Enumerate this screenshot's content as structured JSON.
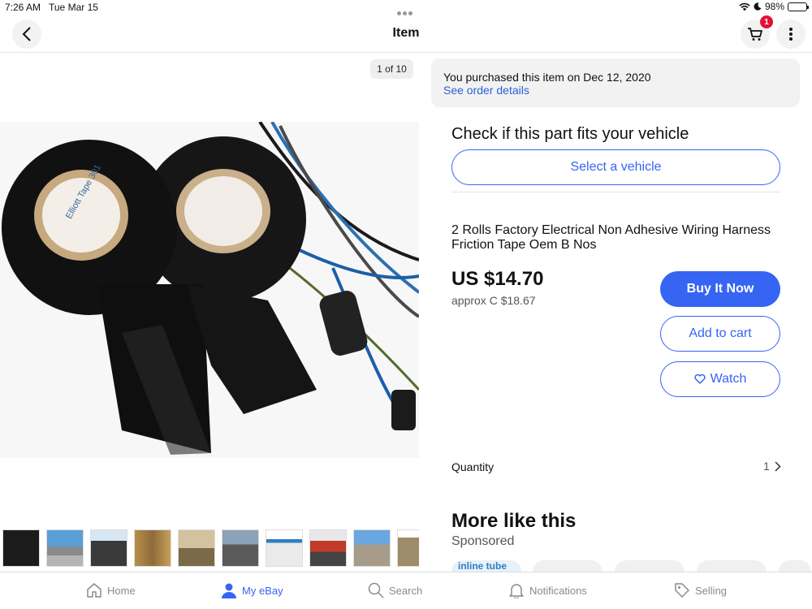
{
  "status_bar": {
    "time": "7:26 AM",
    "date": "Tue Mar 15",
    "battery": "98%",
    "battery_level": 0.98
  },
  "header": {
    "title": "Item",
    "cart_count": "1"
  },
  "gallery": {
    "counter": "1 of 10",
    "tape_label": "Elliott Tape 301",
    "thumbnails": [
      "tape",
      "inline-tube-store",
      "customer-support",
      "warehouse-shelves",
      "warehouse-aisles",
      "workshop",
      "inline-tube-catalog",
      "inline-tube-machine",
      "inline-tube-building",
      "inline-tube-inventory"
    ]
  },
  "purchase": {
    "message": "You purchased this item on Dec 12, 2020",
    "link": "See order details"
  },
  "fitment": {
    "heading": "Check if this part fits your vehicle",
    "button": "Select a vehicle"
  },
  "item": {
    "title": "2 Rolls Factory Electrical Non Adhesive Wiring Harness Friction Tape Oem B Nos",
    "price": "US $14.70",
    "approx": "approx C $18.67"
  },
  "actions": {
    "buy_now": "Buy It Now",
    "add_to_cart": "Add to cart",
    "watch": "Watch"
  },
  "quantity": {
    "label": "Quantity",
    "value": "1"
  },
  "more": {
    "heading": "More like this",
    "sponsored": "Sponsored",
    "first_card_logo": "inline tube"
  },
  "tabs": [
    {
      "label": "Home",
      "icon": "home-icon"
    },
    {
      "label": "My eBay",
      "icon": "person-icon",
      "active": true
    },
    {
      "label": "Search",
      "icon": "search-icon"
    },
    {
      "label": "Notifications",
      "icon": "bell-icon"
    },
    {
      "label": "Selling",
      "icon": "tag-icon"
    }
  ],
  "colors": {
    "accent": "#3665f3",
    "badge": "#e0103a"
  }
}
